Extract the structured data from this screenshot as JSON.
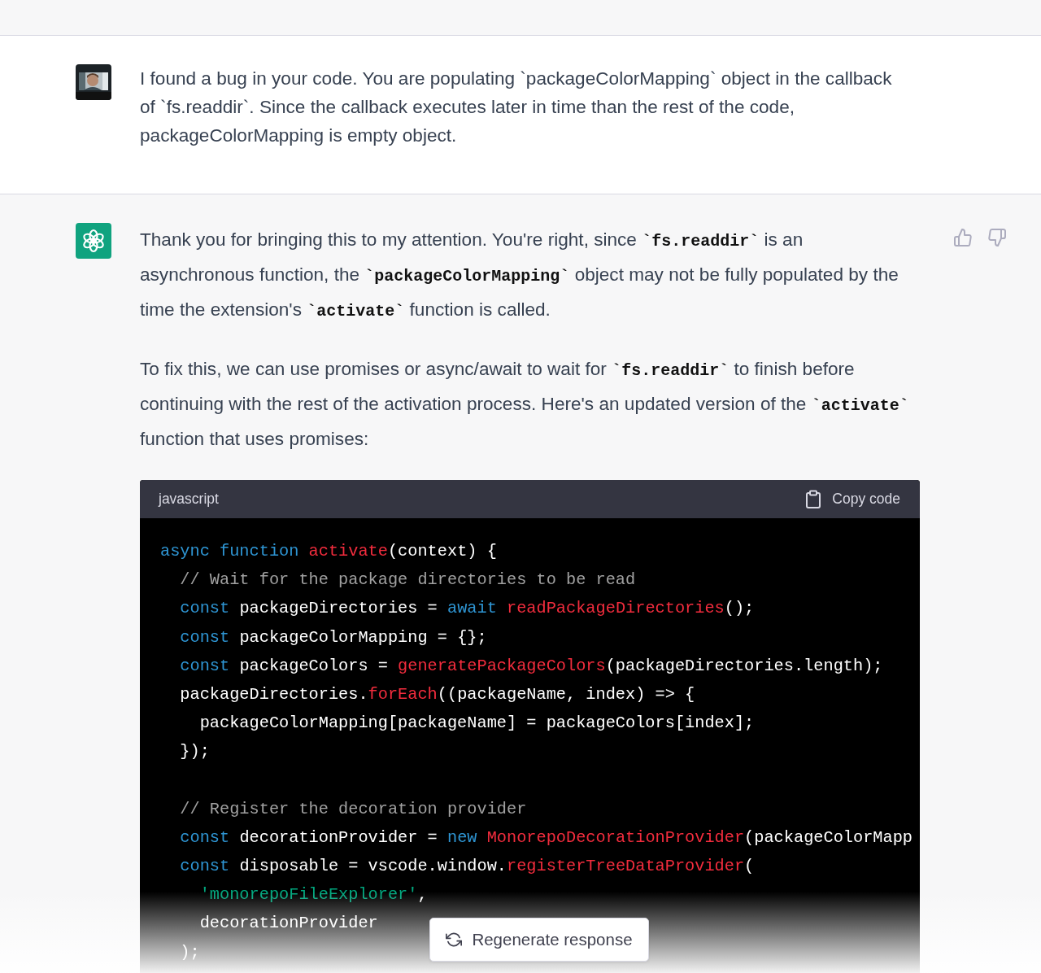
{
  "user_message": {
    "text": "I found a bug in your code. You are populating `packageColorMapping` object in the callback of `fs.readdir`. Since the callback executes later in time than the rest of the code, packageColorMapping is empty object."
  },
  "assistant_message": {
    "paragraphs": [
      [
        {
          "kind": "text",
          "text": "Thank you for bringing this to my attention. You're right, since "
        },
        {
          "kind": "code",
          "text": "`fs.readdir`"
        },
        {
          "kind": "text",
          "text": " is an asynchronous function, the "
        },
        {
          "kind": "code",
          "text": "`packageColorMapping`"
        },
        {
          "kind": "text",
          "text": " object may not be fully populated by the time the extension's "
        },
        {
          "kind": "code",
          "text": "`activate`"
        },
        {
          "kind": "text",
          "text": " function is called."
        }
      ],
      [
        {
          "kind": "text",
          "text": "To fix this, we can use promises or async/await to wait for "
        },
        {
          "kind": "code",
          "text": "`fs.readdir`"
        },
        {
          "kind": "text",
          "text": " to finish before continuing with the rest of the activation process. Here's an updated version of the "
        },
        {
          "kind": "code",
          "text": "`activate`"
        },
        {
          "kind": "text",
          "text": " function that uses promises:"
        }
      ]
    ],
    "code_block": {
      "language": "javascript",
      "copy_label": "Copy code",
      "lines": [
        [
          {
            "kind": "keyword",
            "text": "async function "
          },
          {
            "kind": "func",
            "text": "activate"
          },
          {
            "kind": "plain",
            "text": "(context) {"
          }
        ],
        [
          {
            "kind": "comment",
            "text": "  // Wait for the package directories to be read"
          }
        ],
        [
          {
            "kind": "keyword",
            "text": "  const "
          },
          {
            "kind": "plain",
            "text": "packageDirectories = "
          },
          {
            "kind": "keyword",
            "text": "await "
          },
          {
            "kind": "func",
            "text": "readPackageDirectories"
          },
          {
            "kind": "plain",
            "text": "();"
          }
        ],
        [
          {
            "kind": "keyword",
            "text": "  const "
          },
          {
            "kind": "plain",
            "text": "packageColorMapping = {};"
          }
        ],
        [
          {
            "kind": "keyword",
            "text": "  const "
          },
          {
            "kind": "plain",
            "text": "packageColors = "
          },
          {
            "kind": "func",
            "text": "generatePackageColors"
          },
          {
            "kind": "plain",
            "text": "(packageDirectories.length);"
          }
        ],
        [
          {
            "kind": "plain",
            "text": "  packageDirectories."
          },
          {
            "kind": "func",
            "text": "forEach"
          },
          {
            "kind": "plain",
            "text": "((packageName, index) => {"
          }
        ],
        [
          {
            "kind": "plain",
            "text": "    packageColorMapping[packageName] = packageColors[index];"
          }
        ],
        [
          {
            "kind": "plain",
            "text": "  });"
          }
        ],
        [
          {
            "kind": "comment",
            "text": "  // Register the decoration provider",
            "blank_before": true
          }
        ],
        [
          {
            "kind": "keyword",
            "text": "  const "
          },
          {
            "kind": "plain",
            "text": "decorationProvider = "
          },
          {
            "kind": "keyword",
            "text": "new "
          },
          {
            "kind": "func",
            "text": "MonorepoDecorationProvider"
          },
          {
            "kind": "plain",
            "text": "(packageColorMapp"
          }
        ],
        [
          {
            "kind": "keyword",
            "text": "  const "
          },
          {
            "kind": "plain",
            "text": "disposable = vscode.window."
          },
          {
            "kind": "func",
            "text": "registerTreeDataProvider"
          },
          {
            "kind": "plain",
            "text": "("
          }
        ],
        [
          {
            "kind": "string",
            "text": "    'monorepoFileExplorer'"
          },
          {
            "kind": "plain",
            "text": ","
          }
        ],
        [
          {
            "kind": "plain",
            "text": "    decorationProvider"
          }
        ],
        [
          {
            "kind": "plain",
            "text": "  );"
          }
        ]
      ]
    }
  },
  "regenerate_button": {
    "label": "Regenerate response"
  }
}
